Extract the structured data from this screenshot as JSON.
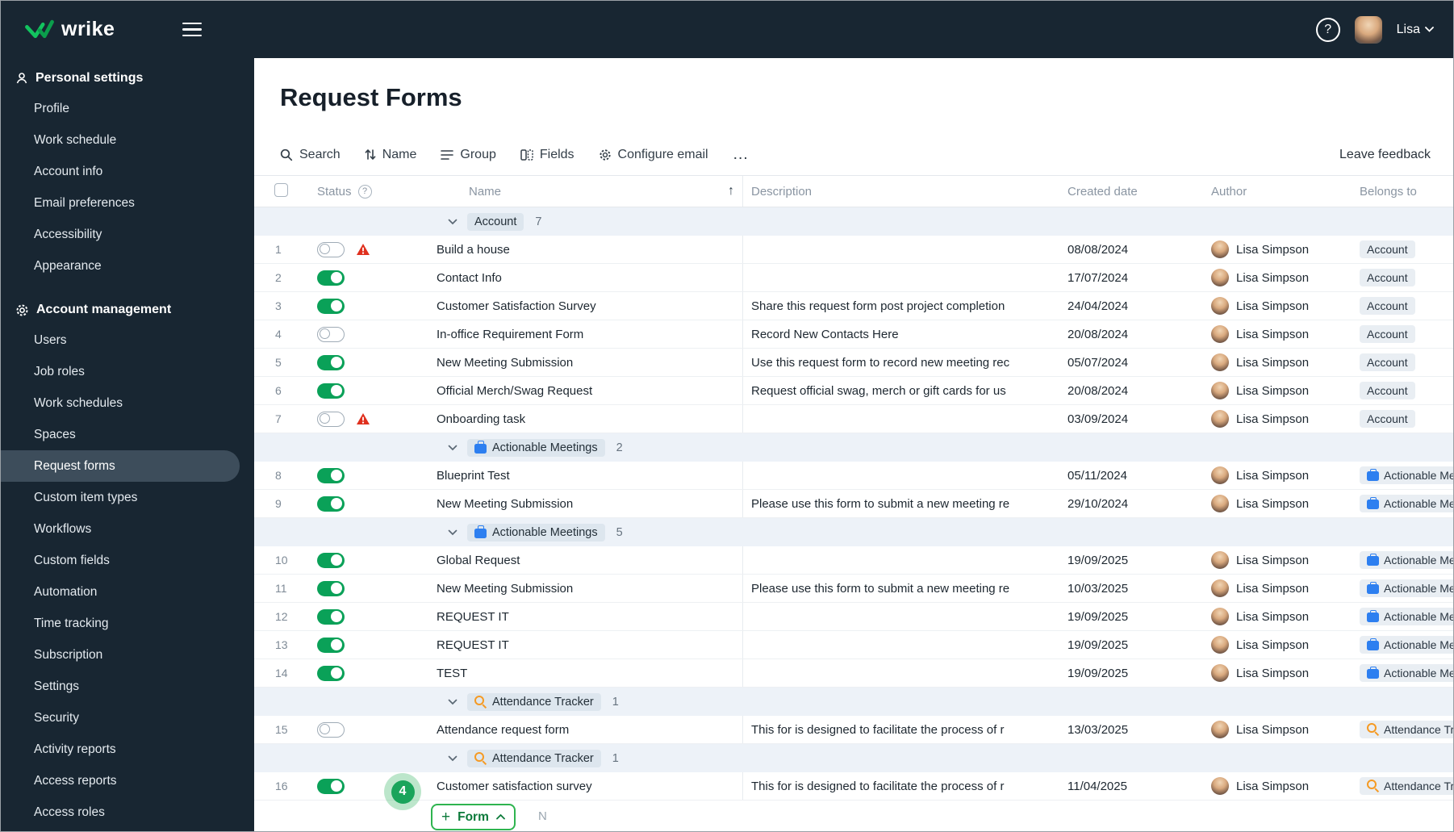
{
  "topbar": {
    "brand": "wrike",
    "user_name": "Lisa",
    "help_glyph": "?"
  },
  "sidebar": {
    "sections": [
      {
        "label": "Personal settings",
        "items": [
          {
            "label": "Profile"
          },
          {
            "label": "Work schedule"
          },
          {
            "label": "Account info"
          },
          {
            "label": "Email preferences"
          },
          {
            "label": "Accessibility"
          },
          {
            "label": "Appearance"
          }
        ]
      },
      {
        "label": "Account management",
        "items": [
          {
            "label": "Users"
          },
          {
            "label": "Job roles"
          },
          {
            "label": "Work schedules"
          },
          {
            "label": "Spaces"
          },
          {
            "label": "Request forms",
            "selected": true
          },
          {
            "label": "Custom item types"
          },
          {
            "label": "Workflows"
          },
          {
            "label": "Custom fields"
          },
          {
            "label": "Automation"
          },
          {
            "label": "Time tracking"
          },
          {
            "label": "Subscription"
          },
          {
            "label": "Settings"
          },
          {
            "label": "Security"
          },
          {
            "label": "Activity reports"
          },
          {
            "label": "Access reports"
          },
          {
            "label": "Access roles"
          }
        ]
      }
    ]
  },
  "main": {
    "title": "Request Forms",
    "toolbar": {
      "search": "Search",
      "sort": "Name",
      "group": "Group",
      "fields": "Fields",
      "configure_email": "Configure email",
      "more": "…",
      "leave_feedback": "Leave feedback"
    },
    "table": {
      "columns": {
        "status": "Status",
        "status_help": "?",
        "name": "Name",
        "sort_arrow": "↑",
        "description": "Description",
        "created": "Created date",
        "author": "Author",
        "belongs": "Belongs to"
      },
      "sections": [
        {
          "name": "Account",
          "count": 7,
          "icon": "none",
          "rows": [
            {
              "num": 1,
              "toggle": "off",
              "warning": true,
              "name": "Build a house",
              "description": "",
              "created": "08/08/2024",
              "author": "Lisa Simpson",
              "belongs": "Account",
              "belongs_icon": "none"
            },
            {
              "num": 2,
              "toggle": "on",
              "warning": false,
              "name": "Contact Info",
              "description": "",
              "created": "17/07/2024",
              "author": "Lisa Simpson",
              "belongs": "Account",
              "belongs_icon": "none"
            },
            {
              "num": 3,
              "toggle": "on",
              "warning": false,
              "name": "Customer Satisfaction Survey",
              "description": "Share this request form post project completion",
              "created": "24/04/2024",
              "author": "Lisa Simpson",
              "belongs": "Account",
              "belongs_icon": "none"
            },
            {
              "num": 4,
              "toggle": "off",
              "warning": false,
              "name": "In-office Requirement Form",
              "description": "Record New Contacts Here",
              "created": "20/08/2024",
              "author": "Lisa Simpson",
              "belongs": "Account",
              "belongs_icon": "none"
            },
            {
              "num": 5,
              "toggle": "on",
              "warning": false,
              "name": "New Meeting Submission",
              "description": "Use this request form to record new meeting rec",
              "created": "05/07/2024",
              "author": "Lisa Simpson",
              "belongs": "Account",
              "belongs_icon": "none"
            },
            {
              "num": 6,
              "toggle": "on",
              "warning": false,
              "name": "Official Merch/Swag Request",
              "description": "Request official swag, merch or gift cards for us",
              "created": "20/08/2024",
              "author": "Lisa Simpson",
              "belongs": "Account",
              "belongs_icon": "none"
            },
            {
              "num": 7,
              "toggle": "off",
              "warning": true,
              "name": "Onboarding task",
              "description": "",
              "created": "03/09/2024",
              "author": "Lisa Simpson",
              "belongs": "Account",
              "belongs_icon": "none"
            }
          ]
        },
        {
          "name": "Actionable Meetings",
          "count": 2,
          "icon": "briefcase",
          "rows": [
            {
              "num": 8,
              "toggle": "on",
              "warning": false,
              "name": "Blueprint Test",
              "description": "",
              "created": "05/11/2024",
              "author": "Lisa Simpson",
              "belongs": "Actionable Meetings",
              "belongs_icon": "briefcase"
            },
            {
              "num": 9,
              "toggle": "on",
              "warning": false,
              "name": "New Meeting Submission",
              "description": "Please use this form to submit a new meeting re",
              "created": "29/10/2024",
              "author": "Lisa Simpson",
              "belongs": "Actionable Meetings",
              "belongs_icon": "briefcase"
            }
          ]
        },
        {
          "name": "Actionable Meetings",
          "count": 5,
          "icon": "briefcase",
          "rows": [
            {
              "num": 10,
              "toggle": "on",
              "warning": false,
              "name": "Global Request",
              "description": "",
              "created": "19/09/2025",
              "author": "Lisa Simpson",
              "belongs": "Actionable Meetings",
              "belongs_icon": "briefcase"
            },
            {
              "num": 11,
              "toggle": "on",
              "warning": false,
              "name": "New Meeting Submission",
              "description": "Please use this form to submit a new meeting re",
              "created": "10/03/2025",
              "author": "Lisa Simpson",
              "belongs": "Actionable Meetings",
              "belongs_icon": "briefcase"
            },
            {
              "num": 12,
              "toggle": "on",
              "warning": false,
              "name": "REQUEST IT",
              "description": "",
              "created": "19/09/2025",
              "author": "Lisa Simpson",
              "belongs": "Actionable Meetings",
              "belongs_icon": "briefcase"
            },
            {
              "num": 13,
              "toggle": "on",
              "warning": false,
              "name": "REQUEST IT",
              "description": "",
              "created": "19/09/2025",
              "author": "Lisa Simpson",
              "belongs": "Actionable Meetings",
              "belongs_icon": "briefcase"
            },
            {
              "num": 14,
              "toggle": "on",
              "warning": false,
              "name": "TEST",
              "description": "",
              "created": "19/09/2025",
              "author": "Lisa Simpson",
              "belongs": "Actionable Meetings",
              "belongs_icon": "briefcase"
            }
          ]
        },
        {
          "name": "Attendance Tracker",
          "count": 1,
          "icon": "magnifier",
          "rows": [
            {
              "num": 15,
              "toggle": "off",
              "warning": false,
              "name": "Attendance request form",
              "description": "This for is designed to facilitate the process of r",
              "created": "13/03/2025",
              "author": "Lisa Simpson",
              "belongs": "Attendance Tracker",
              "belongs_icon": "magnifier"
            }
          ]
        },
        {
          "name": "Attendance Tracker",
          "count": 1,
          "icon": "magnifier",
          "rows": [
            {
              "num": 16,
              "toggle": "on",
              "warning": false,
              "name": "Customer satisfaction survey",
              "description": "This for is designed to facilitate the process of r",
              "created": "11/04/2025",
              "author": "Lisa Simpson",
              "belongs": "Attendance Tracker",
              "belongs_icon": "magnifier"
            }
          ]
        }
      ]
    },
    "footer": {
      "plus": "+",
      "add_form_label": "Form",
      "shortcut_hint": "N",
      "annotation_number": "4"
    }
  },
  "colors": {
    "topbar_bg": "#182632",
    "sidebar_bg": "#182632",
    "selected_bg": "#3d4d5b",
    "accent_green": "#12c45f",
    "toggle_on": "#0aa158",
    "warning_red": "#e0301e",
    "group_row_bg": "#edf2f8",
    "tag_bg": "#e9eef3",
    "form_btn_green": "#2eb44f",
    "annot_green": "#1aa45b"
  }
}
